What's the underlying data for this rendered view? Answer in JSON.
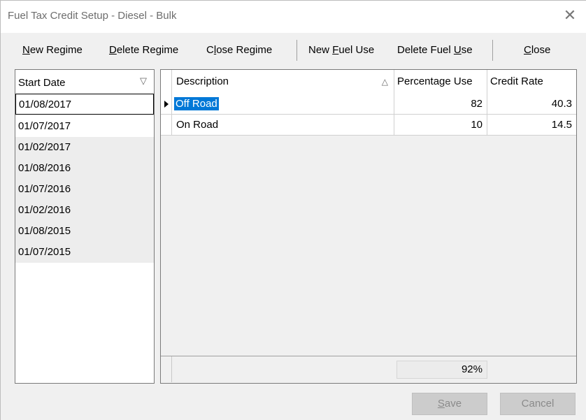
{
  "window": {
    "title": "Fuel Tax Credit Setup - Diesel - Bulk"
  },
  "toolbar": {
    "new_regime": "New Regime",
    "delete_regime": "Delete Regime",
    "close_regime": "Close Regime",
    "new_fuel_use": "New Fuel Use",
    "delete_fuel_use": "Delete Fuel Use",
    "close": "Close"
  },
  "dates": {
    "header": "Start Date",
    "items": [
      "01/08/2017",
      "01/07/2017",
      "01/02/2017",
      "01/08/2016",
      "01/07/2016",
      "01/02/2016",
      "01/08/2015",
      "01/07/2015"
    ]
  },
  "grid": {
    "columns": [
      "Description",
      "Percentage Use",
      "Credit Rate"
    ],
    "rows": [
      {
        "description": "Off Road",
        "percentage": "82",
        "credit_rate": "40.3"
      },
      {
        "description": "On Road",
        "percentage": "10",
        "credit_rate": "14.5"
      }
    ],
    "total": "92%"
  },
  "buttons": {
    "save": "Save",
    "cancel": "Cancel"
  },
  "icons": {
    "close": "close-icon",
    "filter": "filter-icon",
    "sort": "sort-asc-icon",
    "row_pointer": "row-pointer-icon"
  },
  "colors": {
    "selection": "#0078d7",
    "disabled_button": "#cccccc"
  }
}
